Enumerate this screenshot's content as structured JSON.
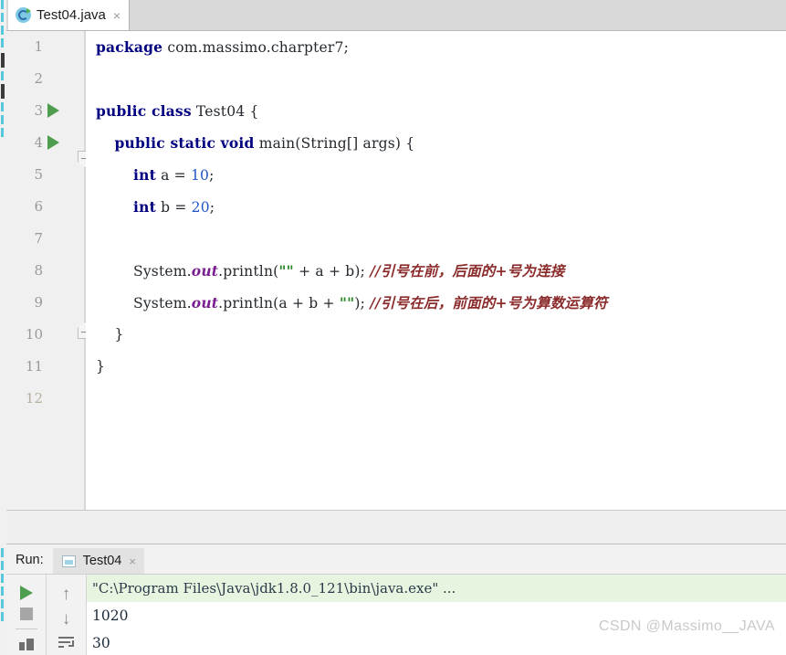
{
  "editor_tab": {
    "title": "Test04.java",
    "icon": "java-class-icon",
    "close": "×"
  },
  "gutter": {
    "line_numbers": [
      "1",
      "2",
      "3",
      "4",
      "5",
      "6",
      "7",
      "8",
      "9",
      "10",
      "11",
      "12"
    ],
    "run_marker_lines": [
      3,
      4
    ],
    "caret_line": 12
  },
  "code": {
    "lines": [
      {
        "n": 1,
        "tokens": [
          {
            "t": "package",
            "c": "kw"
          },
          {
            "t": " com.massimo.charpter7;",
            "c": ""
          }
        ]
      },
      {
        "n": 2,
        "tokens": []
      },
      {
        "n": 3,
        "tokens": [
          {
            "t": "public class",
            "c": "kw"
          },
          {
            "t": " Test04 {",
            "c": ""
          }
        ]
      },
      {
        "n": 4,
        "tokens": [
          {
            "t": "    ",
            "c": ""
          },
          {
            "t": "public static void",
            "c": "kw"
          },
          {
            "t": " main(String[] args) {",
            "c": ""
          }
        ]
      },
      {
        "n": 5,
        "tokens": [
          {
            "t": "        ",
            "c": ""
          },
          {
            "t": "int",
            "c": "kw"
          },
          {
            "t": " a = ",
            "c": ""
          },
          {
            "t": "10",
            "c": "num"
          },
          {
            "t": ";",
            "c": ""
          }
        ]
      },
      {
        "n": 6,
        "tokens": [
          {
            "t": "        ",
            "c": ""
          },
          {
            "t": "int",
            "c": "kw"
          },
          {
            "t": " b = ",
            "c": ""
          },
          {
            "t": "20",
            "c": "num"
          },
          {
            "t": ";",
            "c": ""
          }
        ]
      },
      {
        "n": 7,
        "tokens": []
      },
      {
        "n": 8,
        "tokens": [
          {
            "t": "        System.",
            "c": ""
          },
          {
            "t": "out",
            "c": "fld"
          },
          {
            "t": ".println(",
            "c": ""
          },
          {
            "t": "\"\"",
            "c": "str"
          },
          {
            "t": " + a + b); ",
            "c": ""
          },
          {
            "t": "//引号在前，后面的+号为连接",
            "c": "cmt"
          }
        ]
      },
      {
        "n": 9,
        "tokens": [
          {
            "t": "        System.",
            "c": ""
          },
          {
            "t": "out",
            "c": "fld"
          },
          {
            "t": ".println(a + b + ",
            "c": ""
          },
          {
            "t": "\"\"",
            "c": "str"
          },
          {
            "t": "); ",
            "c": ""
          },
          {
            "t": "//引号在后，前面的+号为算数运算符",
            "c": "cmt"
          }
        ]
      },
      {
        "n": 10,
        "tokens": [
          {
            "t": "    }",
            "c": ""
          }
        ]
      },
      {
        "n": 11,
        "tokens": [
          {
            "t": "}",
            "c": ""
          }
        ]
      },
      {
        "n": 12,
        "tokens": []
      }
    ]
  },
  "run_panel": {
    "label": "Run:",
    "tab_title": "Test04",
    "tab_icon": "console-window-icon",
    "tab_close": "×",
    "toolbar_left": [
      {
        "name": "rerun-button",
        "icon": "play-icon"
      },
      {
        "name": "stop-button",
        "icon": "stop-square-icon"
      },
      {
        "name": "restore-layout-button",
        "icon": "two-squares-icon"
      }
    ],
    "toolbar_right": [
      {
        "name": "prev-occurrence-button",
        "icon": "arrow-up-icon",
        "glyph": "↑"
      },
      {
        "name": "next-occurrence-button",
        "icon": "arrow-down-icon",
        "glyph": "↓"
      },
      {
        "name": "soft-wrap-button",
        "icon": "soft-wrap-icon"
      }
    ],
    "console": {
      "command": "\"C:\\Program Files\\Java\\jdk1.8.0_121\\bin\\java.exe\" ...",
      "output": [
        "1020",
        "30"
      ]
    }
  },
  "watermark": "CSDN @Massimo__JAVA",
  "colors": {
    "keyword": "#000080",
    "number": "#2255cc",
    "string": "#2a8c2a",
    "field": "#7a1f8f",
    "comment": "#8b2b2b",
    "caret_line": "#fdf8e3",
    "command_bg": "#e7f5e0",
    "run_marker": "#4f9e4f"
  }
}
